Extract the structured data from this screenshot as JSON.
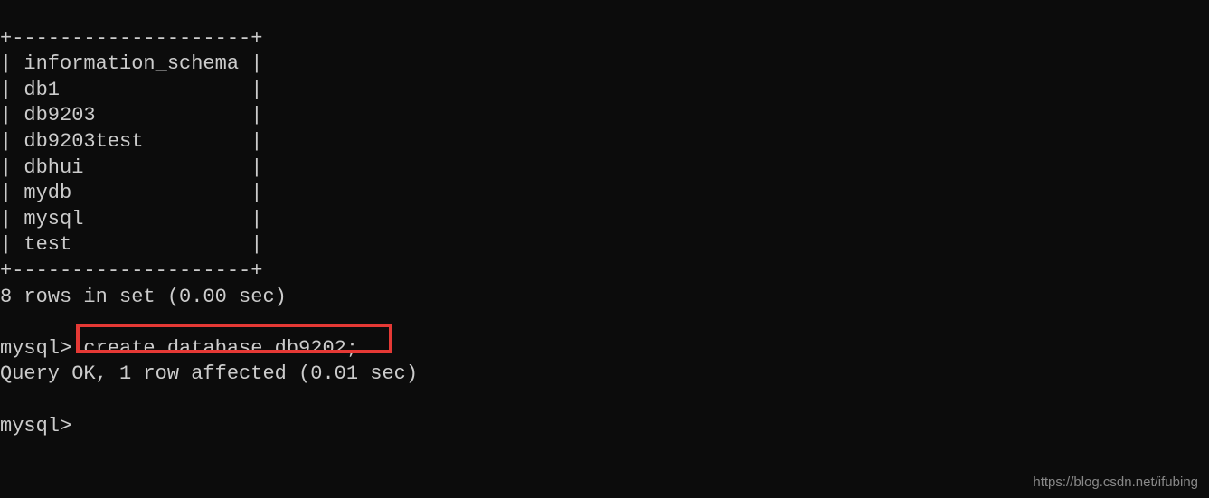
{
  "terminal": {
    "border_top": "+--------------------+",
    "databases": [
      "| information_schema |",
      "| db1                |",
      "| db9203             |",
      "| db9203test         |",
      "| dbhui              |",
      "| mydb               |",
      "| mysql              |",
      "| test               |"
    ],
    "border_bottom": "+--------------------+",
    "result_summary": "8 rows in set (0.00 sec)",
    "blank1": "",
    "prompt1": "mysql> ",
    "command1": "create database db9202;",
    "query_result": "Query OK, 1 row affected (0.01 sec)",
    "blank2": "",
    "prompt2": "mysql> "
  },
  "watermark": "https://blog.csdn.net/ifubing"
}
